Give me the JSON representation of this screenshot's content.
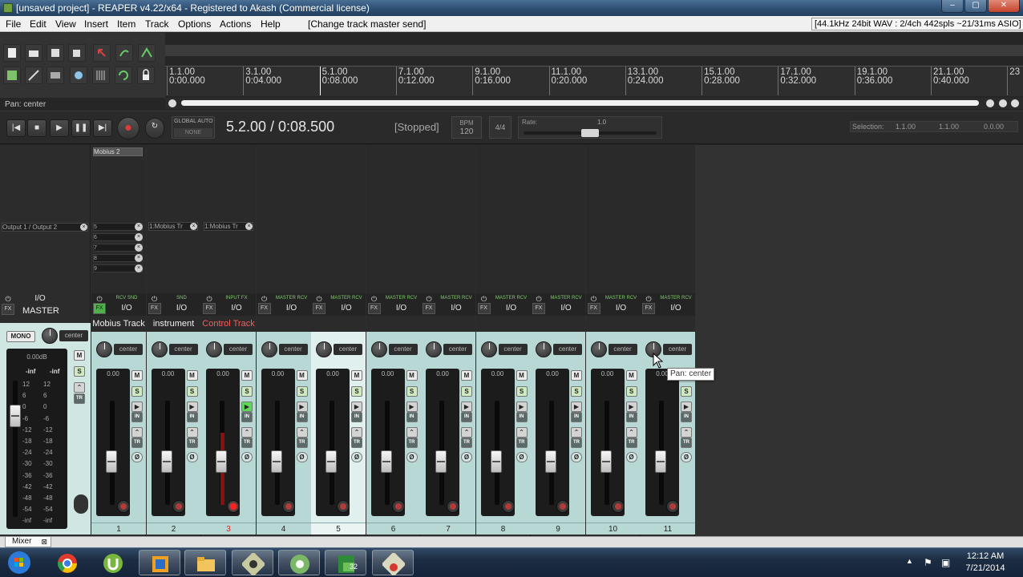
{
  "window": {
    "title": "[unsaved project] - REAPER v4.22/x64 - Registered to Akash (Commercial license)"
  },
  "menu": {
    "items": [
      "File",
      "Edit",
      "View",
      "Insert",
      "Item",
      "Track",
      "Options",
      "Actions",
      "Help"
    ],
    "hint": "[Change track master send]",
    "status": "[44.1kHz 24bit WAV : 2/4ch 442spls ~21/31ms ASIO]"
  },
  "ruler": {
    "marks": [
      {
        "bar": "1.1.00",
        "time": "0:00.000"
      },
      {
        "bar": "3.1.00",
        "time": "0:04.000"
      },
      {
        "bar": "5.1.00",
        "time": "0:08.000"
      },
      {
        "bar": "7.1.00",
        "time": "0:12.000"
      },
      {
        "bar": "9.1.00",
        "time": "0:16.000"
      },
      {
        "bar": "11.1.00",
        "time": "0:20.000"
      },
      {
        "bar": "13.1.00",
        "time": "0:24.000"
      },
      {
        "bar": "15.1.00",
        "time": "0:28.000"
      },
      {
        "bar": "17.1.00",
        "time": "0:32.000"
      },
      {
        "bar": "19.1.00",
        "time": "0:36.000"
      },
      {
        "bar": "21.1.00",
        "time": "0:40.000"
      },
      {
        "bar": "23",
        "time": ""
      }
    ]
  },
  "hint_text": "Pan: center",
  "transport": {
    "global_auto_label": "GLOBAL AUTO",
    "global_auto_value": "NONE",
    "position": "5.2.00 / 0:08.500",
    "state": "[Stopped]",
    "bpm_label": "BPM",
    "bpm_value": "120",
    "time_sig": "4/4",
    "rate_label": "Rate:",
    "rate_value": "1.0",
    "selection_label": "Selection:",
    "selection_start": "1.1.00",
    "selection_end": "1.1.00",
    "selection_length": "0.0.00"
  },
  "fx": {
    "track1_name": "Mobius 2",
    "master_output": "Output 1 / Output 2",
    "track1_slots": [
      "5",
      "6",
      "7",
      "8",
      "9"
    ],
    "track2_send": "1:Mobius Tr",
    "track3_send": "1:Mobius Tr"
  },
  "master": {
    "name": "MASTER",
    "io_label": "I/O",
    "mono_label": "MONO",
    "pan": "center",
    "volume": "0.00dB",
    "peak_left": "-inf",
    "peak_right": "-inf",
    "scale": [
      "12",
      "6",
      "0",
      "-6",
      "-12",
      "-18",
      "-24",
      "-30",
      "-36",
      "-42",
      "-48",
      "-54",
      "-inf"
    ]
  },
  "tracks": [
    {
      "number": "1",
      "name": "Mobius Track",
      "pan": "center",
      "volume": "0.00",
      "route": "RCV SND",
      "io": "I/O",
      "fx_on": true,
      "armed": false,
      "selected": false,
      "color": "#f0f0f0"
    },
    {
      "number": "2",
      "name": "instrument",
      "pan": "center",
      "volume": "0.00",
      "route": "SND",
      "io": "I/O",
      "fx_on": false,
      "armed": false,
      "selected": false,
      "color": "#f0f0f0"
    },
    {
      "number": "3",
      "name": "Control Track",
      "pan": "center",
      "volume": "0.00",
      "route": "INPUT FX",
      "io": "I/O",
      "fx_on": false,
      "armed": true,
      "selected": false,
      "color": "#ff5a5a"
    },
    {
      "number": "4",
      "name": "",
      "pan": "center",
      "volume": "0.00",
      "route": "MASTER RCV",
      "io": "I/O",
      "fx_on": false,
      "armed": false,
      "selected": false,
      "color": "#f0f0f0"
    },
    {
      "number": "5",
      "name": "",
      "pan": "center",
      "volume": "0.00",
      "route": "MASTER RCV",
      "io": "I/O",
      "fx_on": false,
      "armed": false,
      "selected": true,
      "color": "#f0f0f0"
    },
    {
      "number": "6",
      "name": "",
      "pan": "center",
      "volume": "0.00",
      "route": "MASTER RCV",
      "io": "I/O",
      "fx_on": false,
      "armed": false,
      "selected": false,
      "color": "#f0f0f0"
    },
    {
      "number": "7",
      "name": "",
      "pan": "center",
      "volume": "0.00",
      "route": "MASTER RCV",
      "io": "I/O",
      "fx_on": false,
      "armed": false,
      "selected": false,
      "color": "#f0f0f0"
    },
    {
      "number": "8",
      "name": "",
      "pan": "center",
      "volume": "0.00",
      "route": "MASTER RCV",
      "io": "I/O",
      "fx_on": false,
      "armed": false,
      "selected": false,
      "color": "#f0f0f0"
    },
    {
      "number": "9",
      "name": "",
      "pan": "center",
      "volume": "0.00",
      "route": "MASTER RCV",
      "io": "I/O",
      "fx_on": false,
      "armed": false,
      "selected": false,
      "color": "#f0f0f0"
    },
    {
      "number": "10",
      "name": "",
      "pan": "center",
      "volume": "0.00",
      "route": "MASTER RCV",
      "io": "I/O",
      "fx_on": false,
      "armed": false,
      "selected": false,
      "color": "#f0f0f0"
    },
    {
      "number": "11",
      "name": "",
      "pan": "center",
      "volume": "0.00",
      "route": "MASTER RCV",
      "io": "I/O",
      "fx_on": false,
      "armed": false,
      "selected": false,
      "color": "#f0f0f0"
    }
  ],
  "strip_buttons": {
    "mute": "M",
    "solo": "S",
    "input": "IN",
    "trim": "TR",
    "phase": "Ø"
  },
  "tooltip": "Pan: center",
  "mixer_tab": "Mixer",
  "taskbar": {
    "apps": [
      "windows-start",
      "chrome",
      "utorrent",
      "outlook",
      "explorer",
      "reaper",
      "chrome-alt",
      "excel",
      "reaper-alt"
    ],
    "excel_badge": "32",
    "time": "12:12 AM",
    "date": "7/21/2014"
  }
}
